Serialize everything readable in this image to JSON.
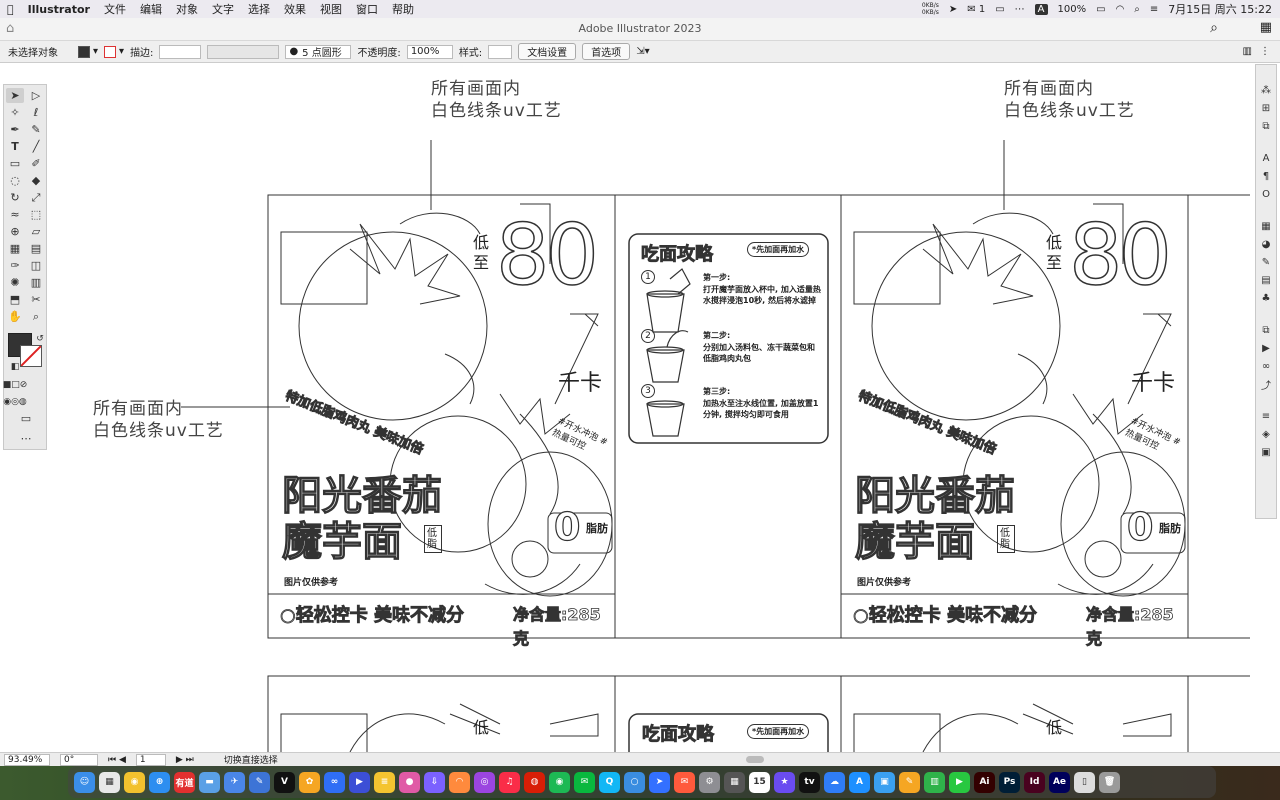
{
  "menubar": {
    "app": "Illustrator",
    "items": [
      "文件",
      "编辑",
      "对象",
      "文字",
      "选择",
      "效果",
      "视图",
      "窗口",
      "帮助"
    ],
    "net_up": "0KB/s",
    "net_down": "0KB/s",
    "wechat_count": "1",
    "input_method": "A",
    "battery": "100%",
    "datetime": "7月15日 周六  15:22"
  },
  "window": {
    "title": "Adobe Illustrator 2023"
  },
  "control": {
    "selection": "未选择对象",
    "stroke_label": "描边:",
    "brush": "5 点圆形",
    "opacity_label": "不透明度:",
    "opacity_value": "100%",
    "style_label": "样式:",
    "doc_setup": "文档设置",
    "prefs": "首选项"
  },
  "canvas": {
    "annotation_lines": [
      "所有画面内",
      "白色线条uv工艺"
    ],
    "package": {
      "low_to": [
        "低",
        "至"
      ],
      "kcal_number": "80",
      "kcal_unit": "千卡",
      "curve_text": "特加低脂鸡肉丸 美味加倍",
      "product_line1": "阳光番茄",
      "product_line2": "魔芋面",
      "vertical_tag": "低脂",
      "zero_fat": "0",
      "zero_fat_label": "脂肪",
      "stamp_text": "#开水冲泡 #热量可控",
      "image_note": "图片仅供参考",
      "bottom_slogan": "○轻松控卡 美味不减分",
      "net_content": "净含量:285克"
    },
    "guide": {
      "title": "吃面攻略",
      "badge": "*先加面再加水",
      "steps": [
        {
          "num": "1",
          "title": "第一步:",
          "text": "打开魔芋面放入杯中, 加入适量热水搅拌浸泡10秒, 然后将水滤掉"
        },
        {
          "num": "2",
          "title": "第二步:",
          "text": "分别加入汤料包、冻干蔬菜包和低脂鸡肉丸包"
        },
        {
          "num": "3",
          "title": "第三步:",
          "text": "加热水至注水线位置, 加盖放置1分钟, 搅拌均匀即可食用"
        }
      ]
    }
  },
  "status": {
    "zoom": "93.49%",
    "rotation": "0°",
    "artboard": "1",
    "tool_hint": "切换直接选择"
  },
  "dock": {
    "apps": [
      {
        "name": "finder",
        "label": "☺",
        "color": "#3b8ee8"
      },
      {
        "name": "launchpad",
        "label": "▦",
        "color": "#e8e8e8"
      },
      {
        "name": "chrome",
        "label": "◉",
        "color": "#f2c12e"
      },
      {
        "name": "safari",
        "label": "⊕",
        "color": "#2d8ef0"
      },
      {
        "name": "youdao",
        "label": "有道",
        "color": "#e2302f"
      },
      {
        "name": "folder",
        "label": "▬",
        "color": "#5aa0e6"
      },
      {
        "name": "vpn",
        "label": "✈",
        "color": "#4a86e8"
      },
      {
        "name": "tool",
        "label": "✎",
        "color": "#3d74d6"
      },
      {
        "name": "capcut",
        "label": "V",
        "color": "#111111"
      },
      {
        "name": "photos",
        "label": "✿",
        "color": "#f5a623"
      },
      {
        "name": "baidu",
        "label": "∞",
        "color": "#2f6ef5"
      },
      {
        "name": "video",
        "label": "▶",
        "color": "#3c4fd6"
      },
      {
        "name": "notes",
        "label": "≡",
        "color": "#f4c430"
      },
      {
        "name": "pink",
        "label": "●",
        "color": "#e05aa6"
      },
      {
        "name": "download",
        "label": "⇩",
        "color": "#7b61ff"
      },
      {
        "name": "rainbow",
        "label": "◠",
        "color": "#ff8a3d"
      },
      {
        "name": "podcasts",
        "label": "◎",
        "color": "#9b45e0"
      },
      {
        "name": "music",
        "label": "♫",
        "color": "#fa2d48"
      },
      {
        "name": "netease",
        "label": "◍",
        "color": "#d81e06"
      },
      {
        "name": "spotify",
        "label": "◉",
        "color": "#1db954"
      },
      {
        "name": "wechat",
        "label": "✉",
        "color": "#09b83e"
      },
      {
        "name": "qq",
        "label": "Q",
        "color": "#12b7f5"
      },
      {
        "name": "search",
        "label": "○",
        "color": "#3a8de0"
      },
      {
        "name": "feishu",
        "label": "➤",
        "color": "#3370ff"
      },
      {
        "name": "mail",
        "label": "✉",
        "color": "#ff5a3c"
      },
      {
        "name": "settings",
        "label": "⚙",
        "color": "#8e8e93"
      },
      {
        "name": "calculator",
        "label": "▦",
        "color": "#555555"
      },
      {
        "name": "calendar",
        "label": "15",
        "color": "#ffffff"
      },
      {
        "name": "star",
        "label": "★",
        "color": "#6a4cf0"
      },
      {
        "name": "appletv",
        "label": "tv",
        "color": "#111111"
      },
      {
        "name": "cloud",
        "label": "☁",
        "color": "#2f7df6"
      },
      {
        "name": "appstore",
        "label": "A",
        "color": "#1e90ff"
      },
      {
        "name": "preview",
        "label": "▣",
        "color": "#3aa0f0"
      },
      {
        "name": "pencil",
        "label": "✎",
        "color": "#f5a623"
      },
      {
        "name": "numbers",
        "label": "▥",
        "color": "#2fb34a"
      },
      {
        "name": "facetime",
        "label": "▶",
        "color": "#28c840"
      },
      {
        "name": "illustrator",
        "label": "Ai",
        "color": "#330000"
      },
      {
        "name": "photoshop",
        "label": "Ps",
        "color": "#001e36"
      },
      {
        "name": "indesign",
        "label": "Id",
        "color": "#49021f"
      },
      {
        "name": "aftereffects",
        "label": "Ae",
        "color": "#00005b"
      },
      {
        "name": "files",
        "label": "▯",
        "color": "#dddddd"
      },
      {
        "name": "trash",
        "label": "🗑",
        "color": "#9a9a9a"
      }
    ]
  }
}
